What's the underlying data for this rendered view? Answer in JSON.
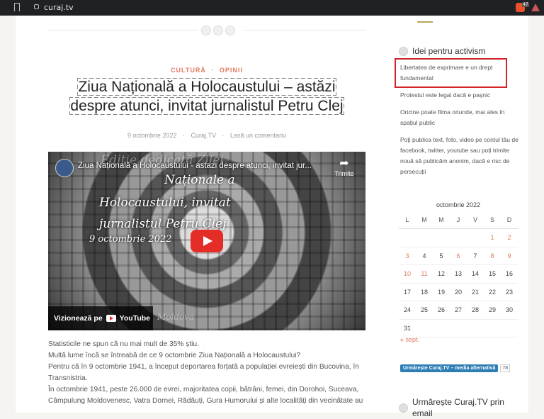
{
  "browser": {
    "url": "curaj.tv"
  },
  "post": {
    "categories": [
      "CULTURĂ",
      "OPINII"
    ],
    "category_sep": "·",
    "title": "Ziua Națională a Holocaustului – astăzi despre atunci, invitat jurnalistul Petru Clej",
    "date": "9 octombrie 2022",
    "author": "Curaj.TV",
    "comment_link": "Lasă un comentariu",
    "paragraphs": [
      "Statisticile ne spun că nu mai mult de 35% știu.",
      "Multă lume încă se întreabă de ce 9 octombrie Ziua Națională a Holocaustului?",
      "Pentru că în 9 octombrie 1941, a început deportarea forțată a populației evreiești din Bucovina, în Transnistria.",
      "În octombrie 1941, peste 26.000 de evrei, majoritatea copii, bătrâni, femei, din Dorohoi, Suceava, Câmpulung Moldovenesc, Vatra Dornei, Rădăuți, Gura Humorului și alte localități din vecinătate au"
    ]
  },
  "video": {
    "title": "Ziua Națională a Holocaustului - astazi despre atunci, invitat jur...",
    "share_label": "Trimite",
    "overlay_faint": "Ediție dedicată Zilei",
    "overlay_lines": [
      "Naționale a",
      "Holocaustului, invitat",
      "jurnalistul Petru Clej",
      "9 octombrie 2022"
    ],
    "watch_label": "Vizionează pe",
    "youtube_label": "YouTube",
    "bottom_text": "Moldova"
  },
  "sidebar": {
    "widget1_title": "Idei pentru activism",
    "links": [
      "Libertatea de exprimare e un drept fundamental",
      "Protestul este legal dacă e pașnic",
      "Oricine poate filma oriunde, mai ales în spațiul public",
      "Poți publica text, foto, video pe contul tău de facebook, twitter, youtube sau poți trimite nouă să publicăm anonim, dacă e risc de persecuții"
    ],
    "calendar": {
      "caption": "octombrie 2022",
      "days": [
        "L",
        "M",
        "M",
        "J",
        "V",
        "S",
        "D"
      ],
      "weeks": [
        [
          "",
          "",
          "",
          "",
          "",
          "1",
          "2"
        ],
        [
          "3",
          "4",
          "5",
          "6",
          "7",
          "8",
          "9"
        ],
        [
          "10",
          "11",
          "12",
          "13",
          "14",
          "15",
          "16"
        ],
        [
          "17",
          "18",
          "19",
          "20",
          "21",
          "22",
          "23"
        ],
        [
          "24",
          "25",
          "26",
          "27",
          "28",
          "29",
          "30"
        ],
        [
          "31",
          "",
          "",
          "",
          "",
          "",
          ""
        ]
      ],
      "prev": "« sept."
    },
    "follow_button": "Urmărește Curaj.TV – media alternativă",
    "follow_count": "78",
    "widget3_title": "Urmărește Curaj.TV prin email"
  },
  "colors": {
    "accent": "#e07a5f",
    "highlight": "#d2232a",
    "youtube": "#e52d27"
  }
}
